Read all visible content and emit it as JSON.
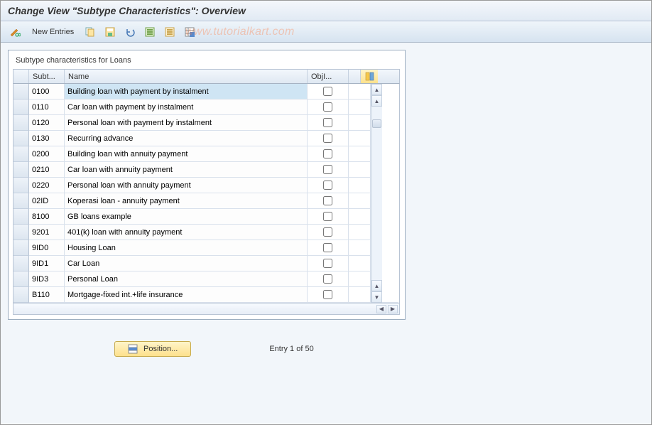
{
  "title": "Change View \"Subtype Characteristics\": Overview",
  "toolbar": {
    "new_entries": "New Entries"
  },
  "watermark": "www.tutorialkart.com",
  "panel": {
    "title": "Subtype characteristics for Loans",
    "columns": {
      "subt": "Subt...",
      "name": "Name",
      "obj": "ObjI..."
    }
  },
  "rows": [
    {
      "subt": "0100",
      "name": "Building loan with payment by instalment",
      "obj": false,
      "selected": true
    },
    {
      "subt": "0110",
      "name": "Car loan with payment by instalment",
      "obj": false
    },
    {
      "subt": "0120",
      "name": "Personal loan with payment by instalment",
      "obj": false
    },
    {
      "subt": "0130",
      "name": "Recurring advance",
      "obj": false
    },
    {
      "subt": "0200",
      "name": "Building loan with annuity payment",
      "obj": false
    },
    {
      "subt": "0210",
      "name": "Car loan with annuity payment",
      "obj": false
    },
    {
      "subt": "0220",
      "name": "Personal loan with annuity payment",
      "obj": false
    },
    {
      "subt": "02ID",
      "name": "Koperasi loan - annuity payment",
      "obj": false
    },
    {
      "subt": "8100",
      "name": "GB loans example",
      "obj": false
    },
    {
      "subt": "9201",
      "name": "401(k) loan with annuity payment",
      "obj": false
    },
    {
      "subt": "9ID0",
      "name": "Housing Loan",
      "obj": false
    },
    {
      "subt": "9ID1",
      "name": "Car Loan",
      "obj": false
    },
    {
      "subt": "9ID3",
      "name": "Personal Loan",
      "obj": false
    },
    {
      "subt": "B110",
      "name": "Mortgage-fixed int.+life insurance",
      "obj": false
    }
  ],
  "footer": {
    "position": "Position...",
    "entry": "Entry 1 of 50"
  }
}
